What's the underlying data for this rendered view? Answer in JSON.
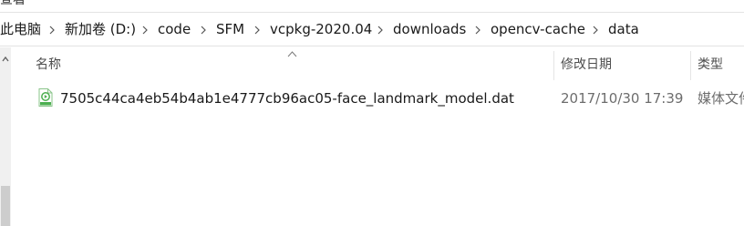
{
  "title_fragment": "查看",
  "breadcrumb": {
    "items": [
      {
        "label": "此电脑"
      },
      {
        "label": "新加卷 (D:)"
      },
      {
        "label": "code"
      },
      {
        "label": "SFM"
      },
      {
        "label": "vcpkg-2020.04"
      },
      {
        "label": "downloads"
      },
      {
        "label": "opencv-cache"
      },
      {
        "label": "data"
      }
    ]
  },
  "columns": {
    "name": "名称",
    "modified": "修改日期",
    "type": "类型",
    "sort_indicator": "ascending"
  },
  "files": [
    {
      "name": "7505c44ca4eb54b4ab1e4777cb96ac05-face_landmark_model.dat",
      "modified": "2017/10/30 17:39",
      "type": "媒体文件",
      "icon": "media-file-icon"
    }
  ],
  "colors": {
    "icon_green": "#4caf50",
    "scroll_track": "#f0f0f0",
    "scroll_thumb": "#cdcdcd"
  }
}
